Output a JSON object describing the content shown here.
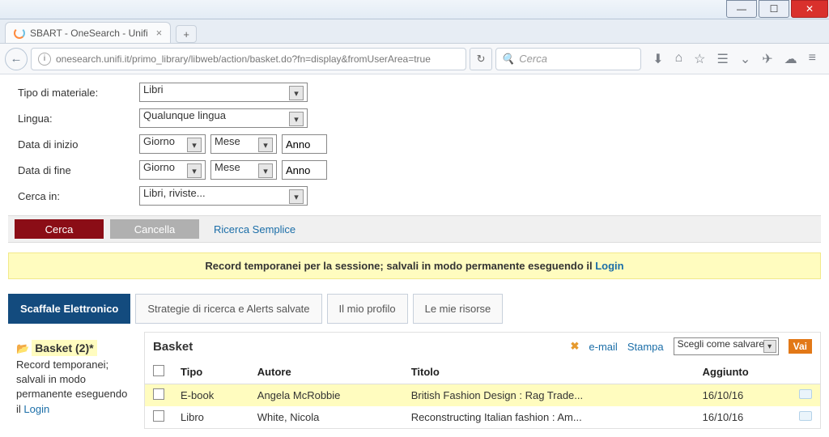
{
  "window": {
    "tab_title": "SBART - OneSearch - Unifi",
    "url": "onesearch.unifi.it/primo_library/libweb/action/basket.do?fn=display&fromUserArea=true",
    "search_placeholder": "Cerca"
  },
  "form": {
    "material_label": "Tipo di materiale:",
    "material_value": "Libri",
    "language_label": "Lingua:",
    "language_value": "Qualunque lingua",
    "date_start_label": "Data di inizio",
    "date_end_label": "Data di fine",
    "day": "Giorno",
    "month": "Mese",
    "year": "Anno",
    "scope_label": "Cerca in:",
    "scope_value": "Libri, riviste..."
  },
  "actions": {
    "search": "Cerca",
    "cancel": "Cancella",
    "simple": "Ricerca Semplice"
  },
  "banner": {
    "text": "Record temporanei per la sessione; salvali in modo permanente eseguendo il ",
    "login": "Login"
  },
  "tabs": {
    "t0": "Scaffale Elettronico",
    "t1": "Strategie di ricerca e Alerts salvate",
    "t2": "Il mio profilo",
    "t3": "Le mie risorse"
  },
  "side": {
    "basket": "Basket (2)*",
    "note": "Record temporanei; salvali in modo permanente eseguendo il ",
    "login": "Login"
  },
  "main": {
    "title": "Basket",
    "email": "e-mail",
    "print": "Stampa",
    "save_select": "Scegli come salvare",
    "go": "Vai",
    "cols": {
      "type": "Tipo",
      "author": "Autore",
      "title": "Titolo",
      "added": "Aggiunto"
    },
    "rows": [
      {
        "type": "E-book",
        "author": "Angela McRobbie",
        "title": "British Fashion Design : Rag Trade...",
        "added": "16/10/16"
      },
      {
        "type": "Libro",
        "author": "White, Nicola",
        "title": "Reconstructing Italian fashion : Am...",
        "added": "16/10/16"
      }
    ]
  }
}
